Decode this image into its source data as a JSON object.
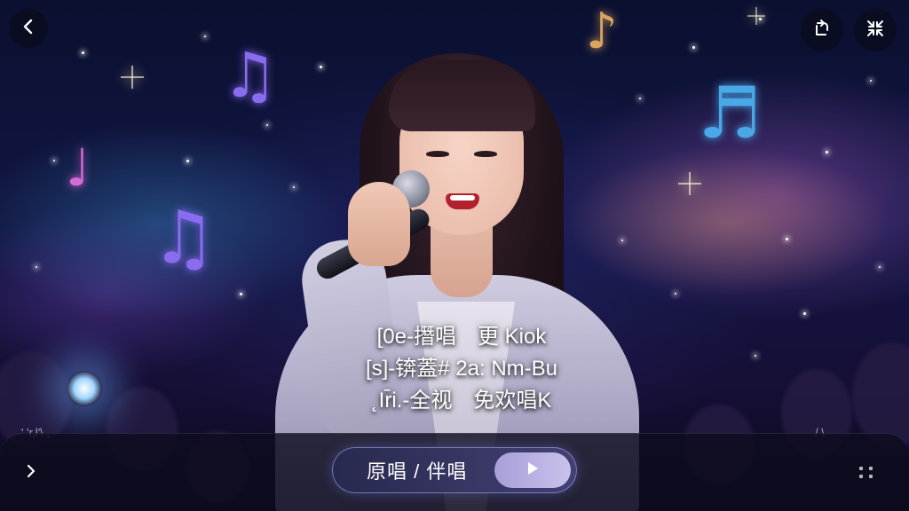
{
  "top_bar": {
    "back_icon": "chevron-left-icon",
    "rotate_icon": "rotate-screen-icon",
    "fullscreen_icon": "exit-fullscreen-icon"
  },
  "lyrics": {
    "lines": [
      "[0e-撍唱　更 Kiok",
      "[s]-锛蓋# 2a: Nm-Bu",
      "˛Ir̄i.-全视　免欢唱K"
    ]
  },
  "bottom_bar": {
    "left_edge_text": "' 'r,l'\\ ,",
    "right_edge_text": "/ \\",
    "expand_icon": "chevron-right-icon",
    "mode_toggle_label": "原唱 / 伴唱",
    "play_icon": "play-icon",
    "more_icon": "grid-dots-icon"
  },
  "colors": {
    "background": "#111643",
    "pill_border": "#96a0e6",
    "play_button": "#b9b1e4",
    "note_purple": "#8a6cf0",
    "note_blue": "#4aa8e8",
    "note_pink": "#d76bd6",
    "note_gold": "#d9a560"
  }
}
